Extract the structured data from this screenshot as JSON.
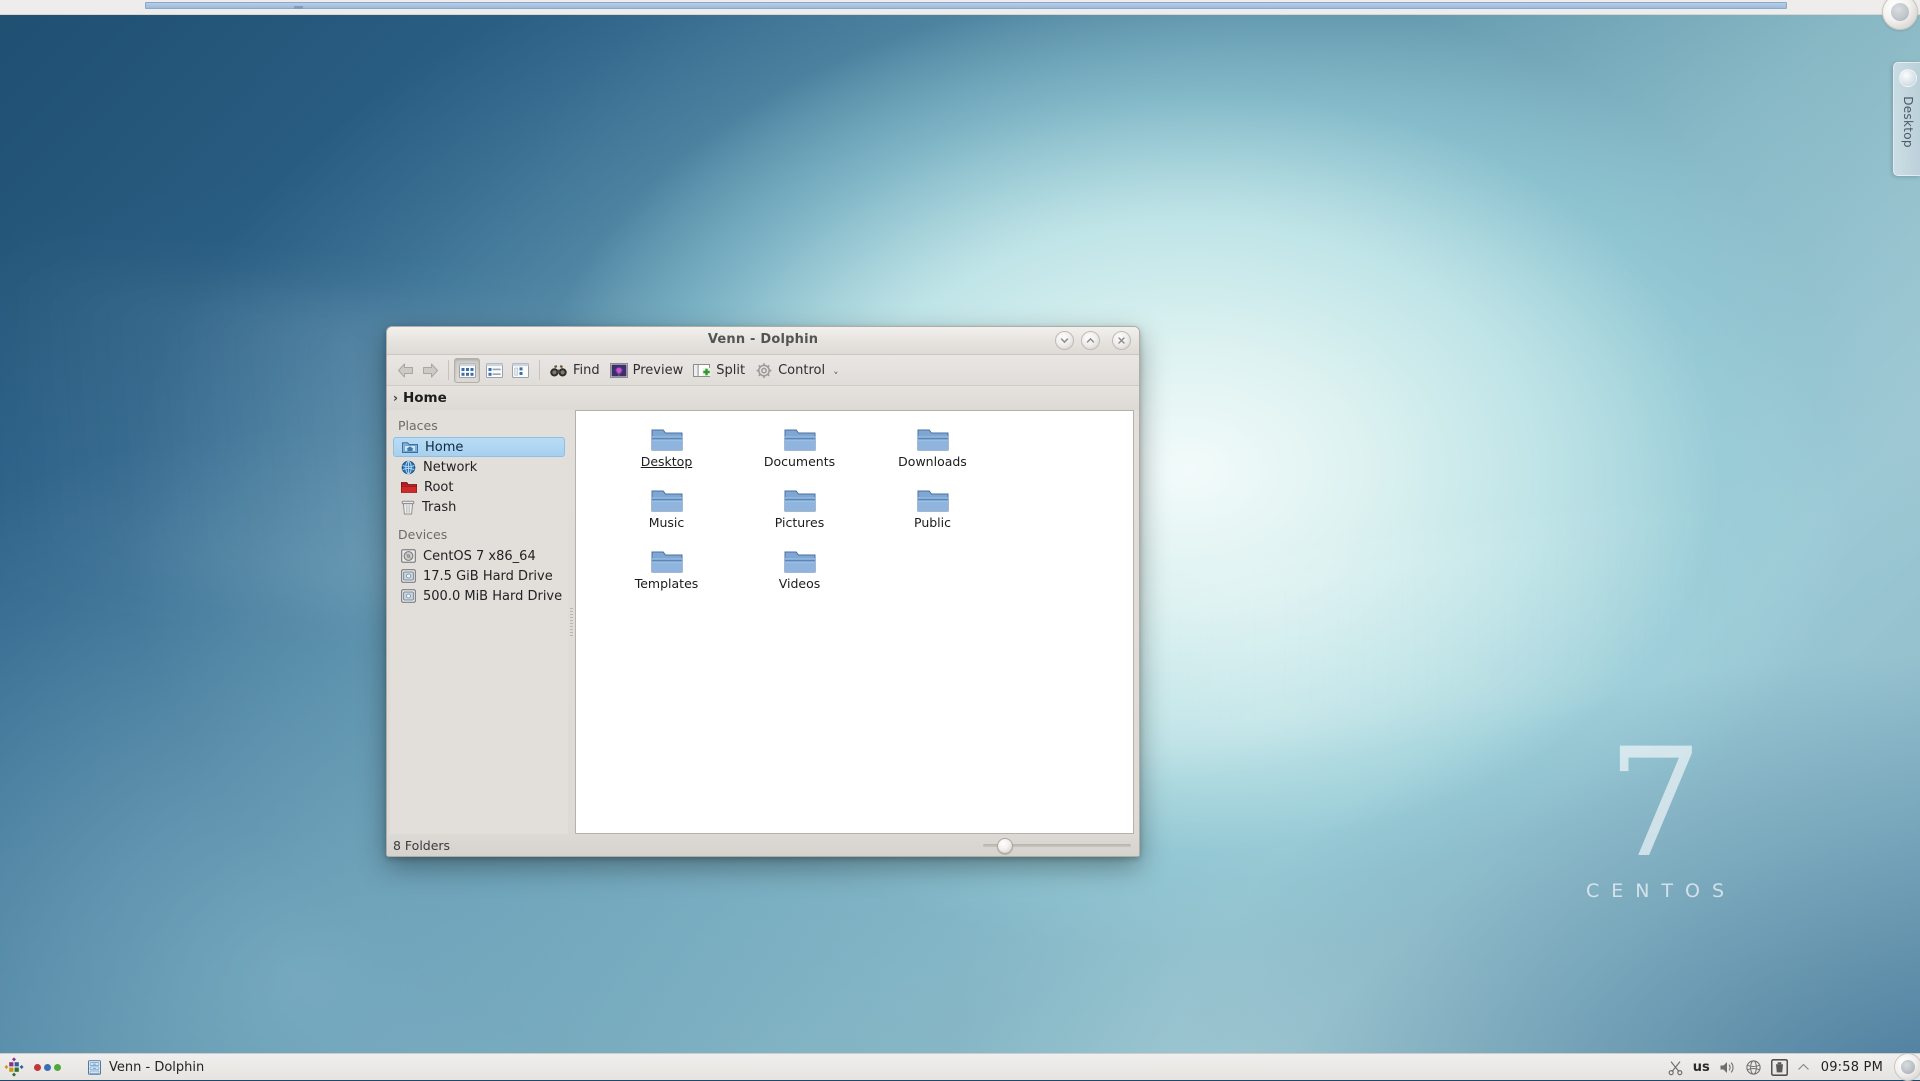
{
  "desktop": {
    "wallpaper_name": "CentOS 7 default wallpaper",
    "watermark_number": "7",
    "watermark_word": "CENTOS",
    "side_tab_label": "Desktop",
    "colors": {
      "wallpaper_dark": "#1f4f71",
      "wallpaper_mid": "#53889f",
      "wallpaper_light": "#ddf2f1",
      "selection_blue": "#a7d0ef",
      "taskbar_bg": "#eceae7"
    }
  },
  "window": {
    "title": "Venn - Dolphin",
    "titlebar_buttons": [
      {
        "name": "minimize",
        "glyph": "chevron-down"
      },
      {
        "name": "maximize",
        "glyph": "chevron-up"
      },
      {
        "name": "close",
        "glyph": "x"
      }
    ],
    "toolbar": {
      "back_label": "Back",
      "forward_label": "Forward",
      "view_modes": [
        {
          "label": "Icons",
          "active": true
        },
        {
          "label": "Compact",
          "active": false
        },
        {
          "label": "Details",
          "active": false
        }
      ],
      "actions": [
        {
          "label": "Find",
          "icon": "binoculars-icon"
        },
        {
          "label": "Preview",
          "icon": "image-preview-icon"
        },
        {
          "label": "Split",
          "icon": "split-view-icon"
        },
        {
          "label": "Control",
          "icon": "gear-icon"
        }
      ],
      "overflow_label": "˅"
    },
    "breadcrumb": {
      "arrow": "›",
      "path": "Home"
    },
    "places": {
      "heading_places": "Places",
      "items": [
        {
          "label": "Home",
          "icon": "home-folder-icon",
          "selected": true
        },
        {
          "label": "Network",
          "icon": "globe-icon",
          "selected": false
        },
        {
          "label": "Root",
          "icon": "red-folder-icon",
          "selected": false
        },
        {
          "label": "Trash",
          "icon": "trash-icon",
          "selected": false
        }
      ],
      "heading_devices": "Devices",
      "devices": [
        {
          "label": "CentOS 7 x86_64",
          "icon": "optical-disc-icon"
        },
        {
          "label": "17.5 GiB Hard Drive",
          "icon": "hard-drive-icon"
        },
        {
          "label": "500.0 MiB Hard Drive",
          "icon": "hard-drive-icon"
        }
      ]
    },
    "folders": [
      {
        "name": "Desktop",
        "hovered": true
      },
      {
        "name": "Documents",
        "hovered": false
      },
      {
        "name": "Downloads",
        "hovered": false
      },
      {
        "name": "Music",
        "hovered": false
      },
      {
        "name": "Pictures",
        "hovered": false
      },
      {
        "name": "Public",
        "hovered": false
      },
      {
        "name": "Templates",
        "hovered": false
      },
      {
        "name": "Videos",
        "hovered": false
      }
    ],
    "statusbar": {
      "text": "8 Folders",
      "zoom_position_percent": 10
    }
  },
  "taskbar": {
    "launcher_icon": "centos-logo-icon",
    "pager": {
      "dots": [
        {
          "color": "#c2373a"
        },
        {
          "color": "#3b6fb5"
        },
        {
          "color": "#4fa83d"
        }
      ]
    },
    "tasks": [
      {
        "label": "Venn - Dolphin",
        "icon": "dolphin-icon",
        "active": true
      }
    ],
    "tray": [
      {
        "name": "klipper-icon",
        "label": "Klipper"
      },
      {
        "name": "keyboard-layout",
        "label": "us"
      },
      {
        "name": "volume-icon",
        "label": "Volume"
      },
      {
        "name": "network-icon",
        "label": "Network"
      },
      {
        "name": "clipboard-icon",
        "label": "Clipboard"
      },
      {
        "name": "show-hidden-icon",
        "label": "Show hidden icons"
      }
    ],
    "clock": "09:58 PM"
  }
}
